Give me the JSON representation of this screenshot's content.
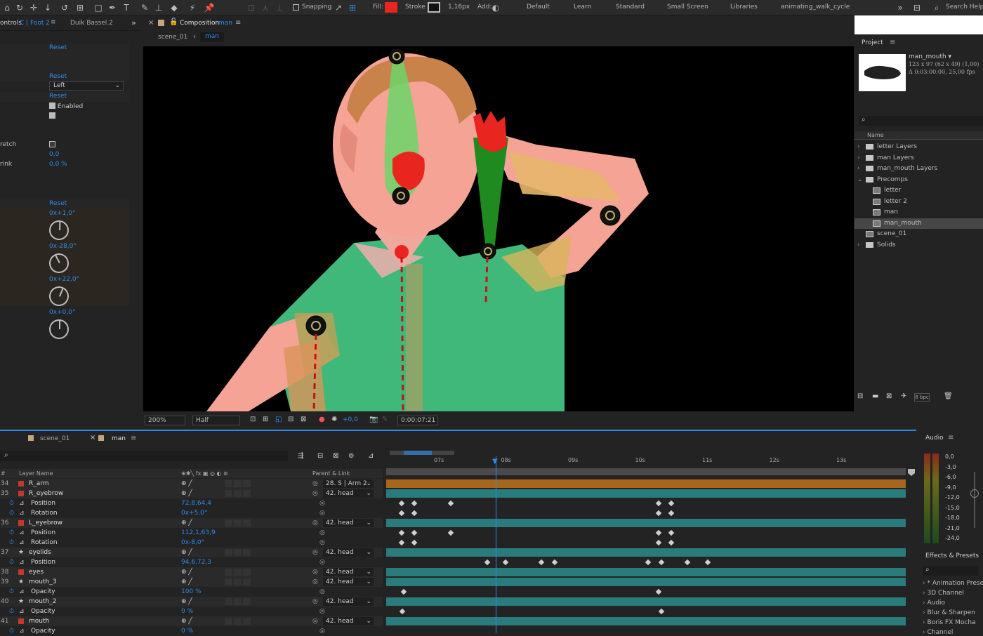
{
  "toolbar": {
    "snapping": "Snapping",
    "fill": "Fill:",
    "stroke": "Stroke",
    "stroke_width": "1,16",
    "stroke_unit": "px",
    "add": "Add:",
    "workspaces": [
      "Default",
      "Learn",
      "Standard",
      "Small Screen",
      "Libraries",
      "animating_walk_cycle"
    ],
    "search": "Search Help",
    "fill_color": "#e8251f"
  },
  "effect_controls": {
    "tab_prefix": "ontrols",
    "tab_target": "C | Foot 2",
    "tab2": "Duik Bassel.2",
    "reset1": "Reset",
    "reset2": "Reset",
    "side_select": "Left",
    "reset3": "Reset",
    "enabled": "Enabled",
    "stretch_label": "retch",
    "stretch_value": "0,0",
    "shrink_label": "rink",
    "shrink_value": "0,0 %",
    "reset4": "Reset",
    "angle1": "0x+1,0°",
    "angle2": "0x-28,0°",
    "angle3": "0x+22,0°",
    "angle4": "0x+0,0°"
  },
  "composition": {
    "tab_title": "Composition",
    "tab_name": "man",
    "crumb1": "scene_01",
    "crumb2": "man",
    "zoom": "200%",
    "resolution": "Half",
    "exposure": "+0,0",
    "timecode": "0:00:07:21"
  },
  "project": {
    "title": "Project",
    "item_name": "man_mouth ▾",
    "item_dims": "123 x 97  (62 x 49) (1,00)",
    "item_dur": "Δ 0:03:00:00, 25,00 fps",
    "col_name": "Name",
    "tree": [
      {
        "label": "letter Layers",
        "kind": "folder",
        "indent": 0,
        "sel": false
      },
      {
        "label": "man Layers",
        "kind": "folder",
        "indent": 0,
        "sel": false
      },
      {
        "label": "man_mouth Layers",
        "kind": "folder",
        "indent": 0,
        "sel": false
      },
      {
        "label": "Precomps",
        "kind": "folder",
        "indent": 0,
        "sel": false
      },
      {
        "label": "letter",
        "kind": "comp",
        "indent": 1,
        "sel": false
      },
      {
        "label": "letter 2",
        "kind": "comp",
        "indent": 1,
        "sel": false
      },
      {
        "label": "man",
        "kind": "comp",
        "indent": 1,
        "sel": false
      },
      {
        "label": "man_mouth",
        "kind": "comp",
        "indent": 1,
        "sel": true
      },
      {
        "label": "scene_01",
        "kind": "comp",
        "indent": 0,
        "sel": false
      },
      {
        "label": "Solids",
        "kind": "folder",
        "indent": 0,
        "sel": false
      }
    ],
    "bpc": "8 bpc"
  },
  "timeline": {
    "tab1": "scene_01",
    "tab2": "man",
    "col_layer": "Layer Name",
    "col_parent": "Parent & Link",
    "rulers": [
      "07s",
      "08s",
      "09s",
      "10s",
      "11s",
      "12s",
      "13s"
    ],
    "rows": [
      {
        "num": "34",
        "name": "R_arm",
        "kind": "layer",
        "val": "",
        "parent": "28. S | Arm 2",
        "color": "#a8651c"
      },
      {
        "num": "35",
        "name": "R_eyebrow",
        "kind": "layer",
        "val": "",
        "parent": "42. head",
        "color": "#2a7b7b"
      },
      {
        "num": "",
        "name": "Position",
        "kind": "prop",
        "val": "72,8,64,4",
        "parent": "",
        "keys": [
          0.026,
          0.05,
          0.12,
          0.52,
          0.545
        ]
      },
      {
        "num": "",
        "name": "Rotation",
        "kind": "prop",
        "val": "0x+5,0°",
        "parent": "",
        "keys": [
          0.026,
          0.05,
          0.52,
          0.545
        ]
      },
      {
        "num": "36",
        "name": "L_eyebrow",
        "kind": "layer",
        "val": "",
        "parent": "42. head",
        "color": "#2a7b7b"
      },
      {
        "num": "",
        "name": "Position",
        "kind": "prop",
        "val": "112,1,63,9",
        "parent": "",
        "keys": [
          0.026,
          0.05,
          0.12,
          0.52,
          0.545
        ]
      },
      {
        "num": "",
        "name": "Rotation",
        "kind": "prop",
        "val": "0x-8,0°",
        "parent": "",
        "keys": [
          0.026,
          0.05,
          0.52,
          0.545
        ]
      },
      {
        "num": "37",
        "name": "eyelids",
        "kind": "layer",
        "val": "",
        "parent": "42. head",
        "color": "#2a7b7b"
      },
      {
        "num": "",
        "name": "Position",
        "kind": "prop",
        "val": "94,6,72,3",
        "parent": "",
        "keys": [
          0.19,
          0.225,
          0.295,
          0.32,
          0.5,
          0.525,
          0.575,
          0.615
        ]
      },
      {
        "num": "38",
        "name": "eyes",
        "kind": "layer",
        "val": "",
        "parent": "42. head",
        "color": "#2a7b7b"
      },
      {
        "num": "39",
        "name": "mouth_3",
        "kind": "layer",
        "val": "",
        "parent": "42. head",
        "color": "#2a7b7b"
      },
      {
        "num": "",
        "name": "Opacity",
        "kind": "prop",
        "val": "100 %",
        "parent": "",
        "keys": [
          0.03,
          0.52
        ]
      },
      {
        "num": "40",
        "name": "mouth_2",
        "kind": "layer",
        "val": "",
        "parent": "42. head",
        "color": "#2a7b7b"
      },
      {
        "num": "",
        "name": "Opacity",
        "kind": "prop",
        "val": "0 %",
        "parent": "",
        "keys": [
          0.027,
          0.525
        ]
      },
      {
        "num": "41",
        "name": "mouth",
        "kind": "layer",
        "val": "",
        "parent": "42. head",
        "color": "#2a7b7b"
      },
      {
        "num": "",
        "name": "Opacity",
        "kind": "prop",
        "val": "0 %",
        "parent": "",
        "keys": []
      }
    ]
  },
  "audio": {
    "title": "Audio",
    "levels": [
      "0,0",
      "-3,0",
      "-6,0",
      "-9,0",
      "-12,0",
      "-15,0",
      "-18,0",
      "-21,0",
      "-24,0"
    ]
  },
  "effects": {
    "title": "Effects & Presets",
    "items": [
      "* Animation Presets",
      "3D Channel",
      "Audio",
      "Blur & Sharpen",
      "Boris FX Mocha",
      "Channel"
    ]
  }
}
